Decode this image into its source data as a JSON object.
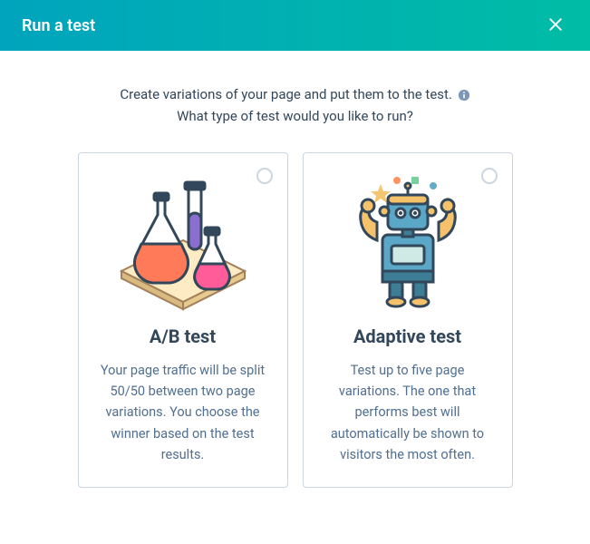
{
  "header": {
    "title": "Run a test"
  },
  "intro": {
    "line1": "Create variations of your page and put them to the test.",
    "line2": "What type of test would you like to run?"
  },
  "cards": [
    {
      "title": "A/B test",
      "description": "Your page traffic will be split 50/50 between two page variations. You choose the winner based on the test results."
    },
    {
      "title": "Adaptive test",
      "description": "Test up to five page variations. The one that performs best will automatically be shown to visitors the most often."
    }
  ]
}
